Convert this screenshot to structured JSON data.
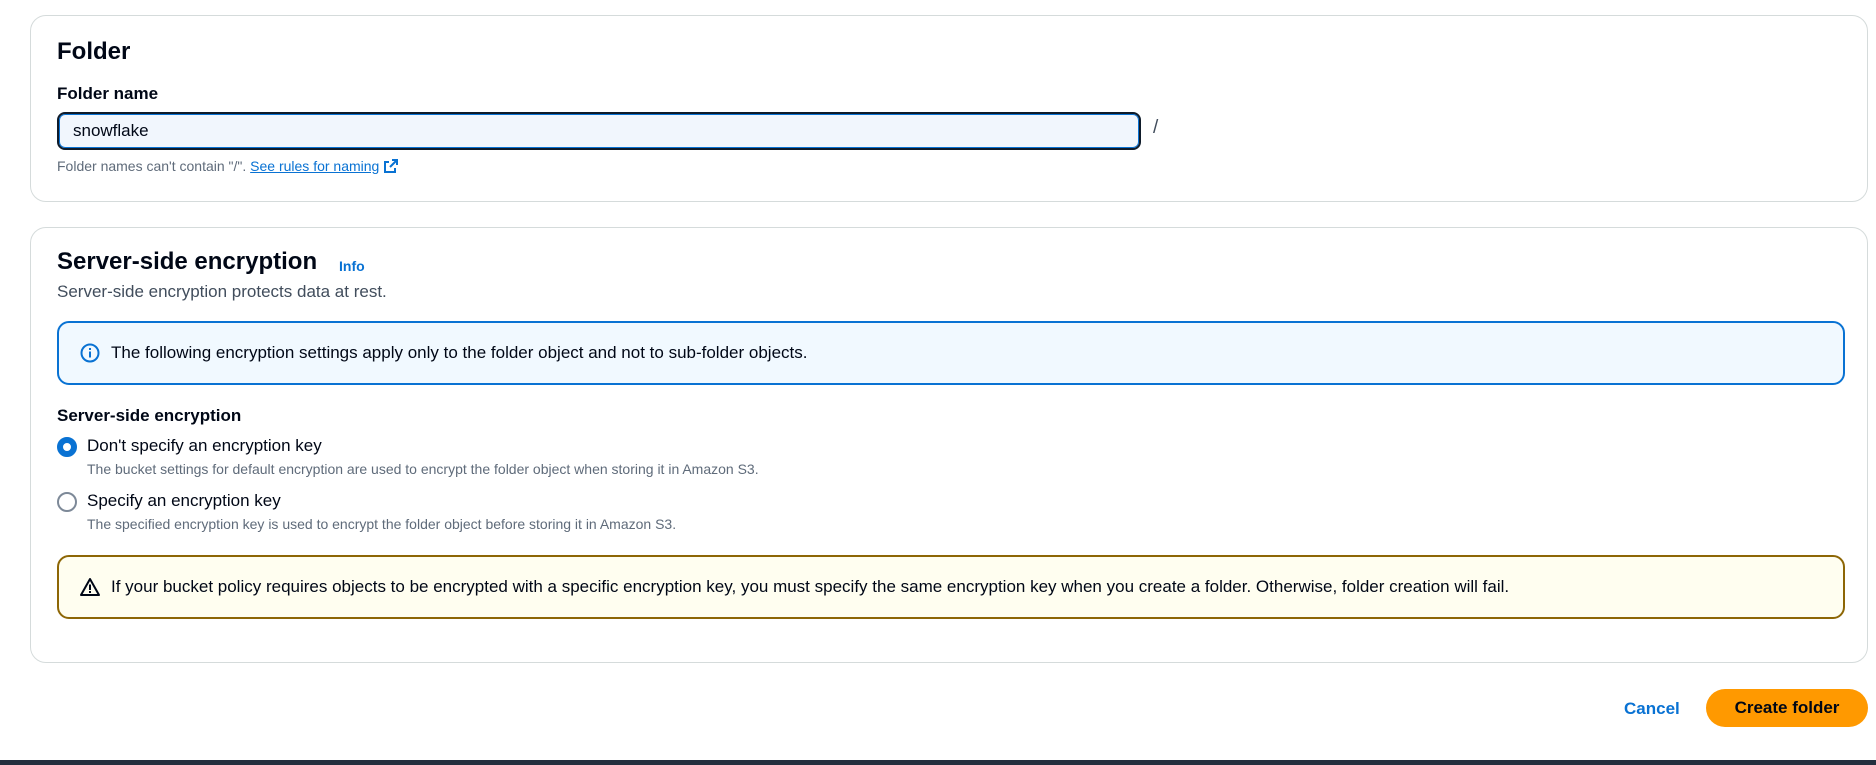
{
  "folder": {
    "title": "Folder",
    "name_label": "Folder name",
    "name_value": "snowflake",
    "slash": "/",
    "hint_text": "Folder names can't contain \"/\". ",
    "hint_link": "See rules for naming"
  },
  "encryption": {
    "title": "Server-side encryption",
    "info_link": "Info",
    "description": "Server-side encryption protects data at rest.",
    "info_alert": "The following encryption settings apply only to the folder object and not to sub-folder objects.",
    "group_label": "Server-side encryption",
    "options": [
      {
        "label": "Don't specify an encryption key",
        "description": "The bucket settings for default encryption are used to encrypt the folder object when storing it in Amazon S3.",
        "selected": true
      },
      {
        "label": "Specify an encryption key",
        "description": "The specified encryption key is used to encrypt the folder object before storing it in Amazon S3.",
        "selected": false
      }
    ],
    "warning_alert": "If your bucket policy requires objects to be encrypted with a specific encryption key, you must specify the same encryption key when you create a folder. Otherwise, folder creation will fail."
  },
  "actions": {
    "cancel_label": "Cancel",
    "create_label": "Create folder"
  },
  "icons": {
    "external_link": "external-link-icon",
    "info": "info-circle-icon",
    "warning": "warning-triangle-icon"
  },
  "colors": {
    "accent": "#0972d3",
    "primary_button": "#ff9900",
    "warning_border": "#8d6605",
    "text": "#000716"
  }
}
